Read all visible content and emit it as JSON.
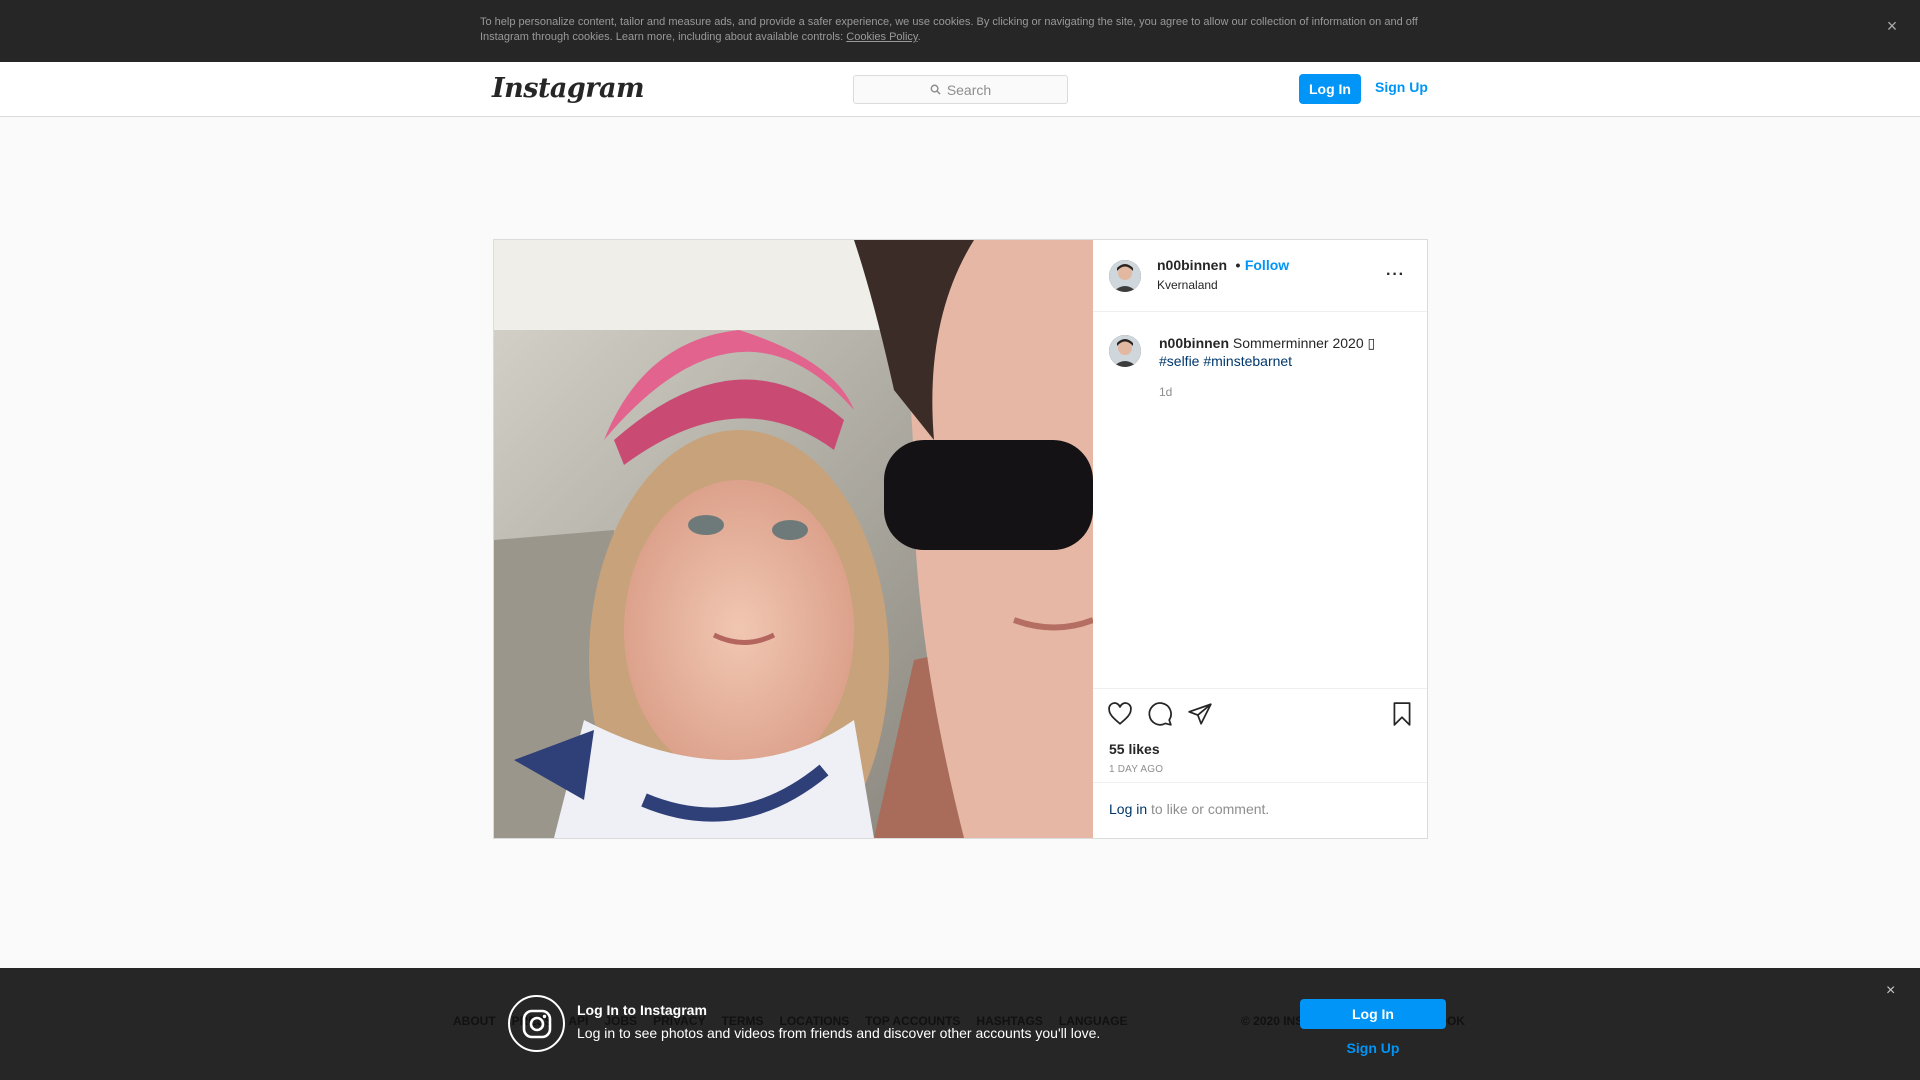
{
  "cookie_banner": {
    "text": "To help personalize content, tailor and measure ads, and provide a safer experience, we use cookies. By clicking or navigating the site, you agree to allow our collection of information on and off Instagram through cookies. Learn more, including about available controls: ",
    "link": "Cookies Policy",
    "after_link": ".",
    "close": "×"
  },
  "header": {
    "logo": "Instagram",
    "search_placeholder": "Search",
    "login": "Log In",
    "signup": "Sign Up"
  },
  "post": {
    "username": "n00binnen",
    "follow": "Follow",
    "dot": "•",
    "location": "Kvernaland",
    "more": "···",
    "caption_user": "n00binnen",
    "caption_text": "Sommerminner 2020 ",
    "caption_emoji": "▯",
    "hashtags": [
      "#selfie",
      "#minstebarnet"
    ],
    "age_short": "1d",
    "likes": "55 likes",
    "age_long": "1 DAY AGO",
    "comment_login": "Log in",
    "comment_rest": " to like or comment."
  },
  "footer": {
    "links": [
      "ABOUT",
      "PRESS",
      "API",
      "JOBS",
      "PRIVACY",
      "TERMS",
      "LOCATIONS",
      "TOP ACCOUNTS",
      "HASHTAGS",
      "LANGUAGE"
    ],
    "copyright": "© 2020 INSTAGRAM FROM FACEBOOK"
  },
  "login_overlay": {
    "title": "Log In to Instagram",
    "subtitle": "Log in to see photos and videos from friends and discover other accounts you'll love.",
    "login": "Log In",
    "signup": "Sign Up",
    "close": "×"
  }
}
